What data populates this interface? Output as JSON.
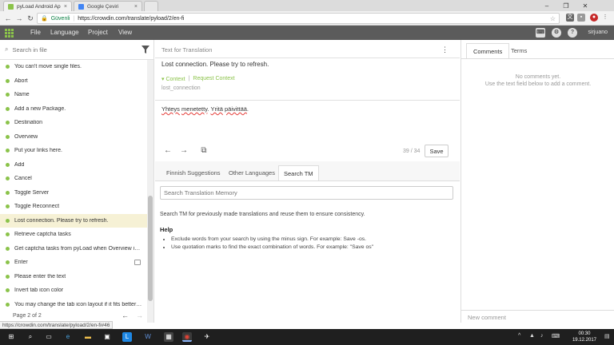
{
  "browser": {
    "tabs": [
      {
        "title": "pyLoad Android App - p",
        "active": true,
        "favicon_color": "#8bc34a"
      },
      {
        "title": "Google Çeviri",
        "active": false,
        "favicon_color": "#4285f4"
      }
    ],
    "secure_label": "Güvenli",
    "url": "https://crowdin.com/translate/pyload/2/en-fi",
    "status_url": "https://crowdin.com/translate/pyload/2/en-fi#46"
  },
  "appbar": {
    "menu": [
      "File",
      "Language",
      "Project",
      "View"
    ],
    "username": "sirjuano"
  },
  "left": {
    "search_placeholder": "Search in file",
    "items": [
      {
        "label": "You can't move single files.",
        "active": false,
        "comment": false
      },
      {
        "label": "Abort",
        "active": false,
        "comment": false
      },
      {
        "label": "Name",
        "active": false,
        "comment": false
      },
      {
        "label": "Add a new Package.",
        "active": false,
        "comment": false
      },
      {
        "label": "Destination",
        "active": false,
        "comment": false
      },
      {
        "label": "Overview",
        "active": false,
        "comment": false
      },
      {
        "label": "Put your links here.",
        "active": false,
        "comment": false
      },
      {
        "label": "Add",
        "active": false,
        "comment": false
      },
      {
        "label": "Cancel",
        "active": false,
        "comment": false
      },
      {
        "label": "Toggle Server",
        "active": false,
        "comment": false
      },
      {
        "label": "Toggle Reconnect",
        "active": false,
        "comment": false
      },
      {
        "label": "Lost connection. Please try to refresh.",
        "active": true,
        "comment": false
      },
      {
        "label": "Retrieve captcha tasks",
        "active": false,
        "comment": false
      },
      {
        "label": "Get captcha tasks from pyLoad when Overview is ...",
        "active": false,
        "comment": false
      },
      {
        "label": "Enter",
        "active": false,
        "comment": true
      },
      {
        "label": "Please enter the text",
        "active": false,
        "comment": false
      },
      {
        "label": "Invert tab icon color",
        "active": false,
        "comment": false
      },
      {
        "label": "You may change the tab icon layout if it fits better ...",
        "active": false,
        "comment": false
      }
    ],
    "pager": "Page 2 of 2"
  },
  "editor": {
    "source_header": "Text for Translation",
    "source_text": "Lost connection. Please try to refresh.",
    "context_label": "Context",
    "request_context_label": "Request Context",
    "string_key": "lost_connection",
    "translation_words": [
      "Yhteys",
      " ",
      "menetetty",
      ". ",
      "Yritä",
      " ",
      "päivittää",
      "."
    ],
    "counter": "39 / 34",
    "save_label": "Save"
  },
  "tm": {
    "tabs": [
      "Finnish Suggestions",
      "Other Languages",
      "Search TM"
    ],
    "active_tab": 2,
    "search_placeholder": "Search Translation Memory",
    "info": "Search TM for previously made translations and reuse them to ensure consistency.",
    "help_title": "Help",
    "help_items": [
      "Exclude words from your search by using the minus sign. For example: Save -os.",
      "Use quotation marks to find the exact combination of words. For example: \"Save os\""
    ]
  },
  "comments": {
    "tabs": [
      "Comments",
      "Terms"
    ],
    "empty_line1": "No comments yet.",
    "empty_line2": "Use the text field below to add a comment.",
    "new_comment_placeholder": "New comment"
  },
  "taskbar": {
    "time": "00:30",
    "date": "19.12.2017"
  },
  "colors": {
    "accent": "#8bc34a",
    "header": "#5b5b5b",
    "active_row": "#f6f1d5"
  }
}
